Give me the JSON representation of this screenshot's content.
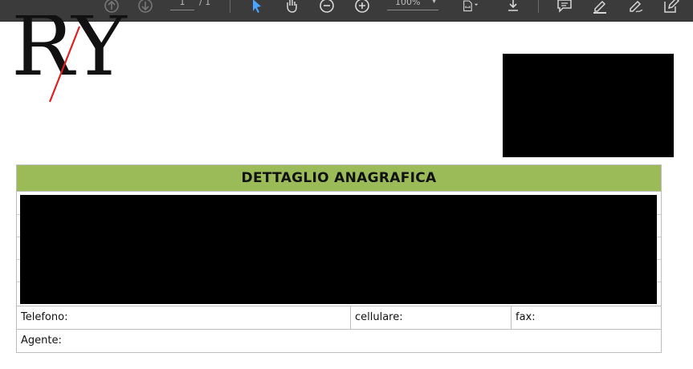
{
  "toolbar": {
    "page_current": "1",
    "page_total": "/ 1",
    "zoom": "100%",
    "icons": [
      "page-up-icon",
      "page-down-icon",
      "select-cursor-icon",
      "hand-icon",
      "zoom-out-icon",
      "zoom-in-icon",
      "fit-page-icon",
      "download-icon",
      "comment-icon",
      "highlight-icon",
      "sign-icon",
      "edit-icon"
    ]
  },
  "document": {
    "logo_text": "RY",
    "table": {
      "title": "DETTAGLIO ANAGRAFICA",
      "phone_label": "Telefono:",
      "mobile_label": "cellulare:",
      "fax_label": "fax:",
      "agent_label": "Agente:"
    }
  },
  "colors": {
    "toolbar_bg": "#3b3b3b",
    "header_green": "#9bbb59",
    "accent_blue": "#4aa3ff",
    "logo_slash_red": "#e02020"
  }
}
